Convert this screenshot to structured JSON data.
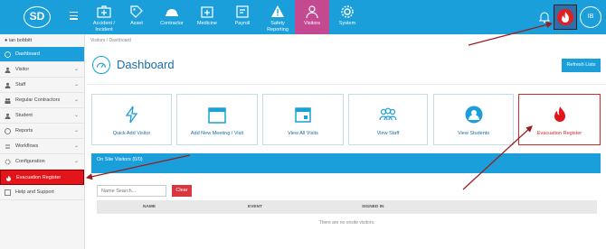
{
  "topbar": {
    "logo_text": "SD",
    "nav": [
      {
        "label": "Accident / Incident",
        "icon": "first-aid-kit-icon"
      },
      {
        "label": "Asset",
        "icon": "tag-icon"
      },
      {
        "label": "Contractor",
        "icon": "hard-hat-icon"
      },
      {
        "label": "Medicine",
        "icon": "medicine-box-icon"
      },
      {
        "label": "Payroll",
        "icon": "payroll-icon"
      },
      {
        "label": "Safety Reporting",
        "icon": "warning-icon"
      },
      {
        "label": "Visitors",
        "icon": "person-icon"
      },
      {
        "label": "System",
        "icon": "gear-icon"
      }
    ],
    "avatar_initials": "IB"
  },
  "sidebar": {
    "user_name": "ian bobbitt",
    "items": [
      {
        "label": "Dashboard"
      },
      {
        "label": "Visitor"
      },
      {
        "label": "Staff"
      },
      {
        "label": "Regular Contractors"
      },
      {
        "label": "Student"
      },
      {
        "label": "Reports"
      },
      {
        "label": "Workflows"
      },
      {
        "label": "Configuration"
      },
      {
        "label": "Evacuation Register"
      },
      {
        "label": "Help and Support"
      }
    ]
  },
  "breadcrumb": {
    "root": "Visitors",
    "sep": "/",
    "current": "Dashboard"
  },
  "page_title": "Dashboard",
  "refresh_label": "Refresh Lists",
  "tiles": [
    {
      "label": "Quick Add Visitor",
      "icon": "lightning-icon"
    },
    {
      "label": "Add New Meeting / Visit",
      "icon": "calendar-icon"
    },
    {
      "label": "View All Visits",
      "icon": "calendar-view-icon"
    },
    {
      "label": "View Staff",
      "icon": "group-icon"
    },
    {
      "label": "View Students",
      "icon": "student-icon"
    },
    {
      "label": "Evacuation Register",
      "icon": "fire-icon"
    }
  ],
  "onsite": {
    "title": "On Site Visitors (0/0)",
    "search_placeholder": "Name Search...",
    "clear_label": "Clear",
    "columns": [
      "NAME",
      "EVENT",
      "SIGNED IN"
    ],
    "empty_text": "There are no onsite visitors."
  },
  "colors": {
    "primary": "#1a9fdb",
    "active_nav": "#c34a91",
    "danger": "#e3141a",
    "arrow": "#9b1c1c"
  }
}
